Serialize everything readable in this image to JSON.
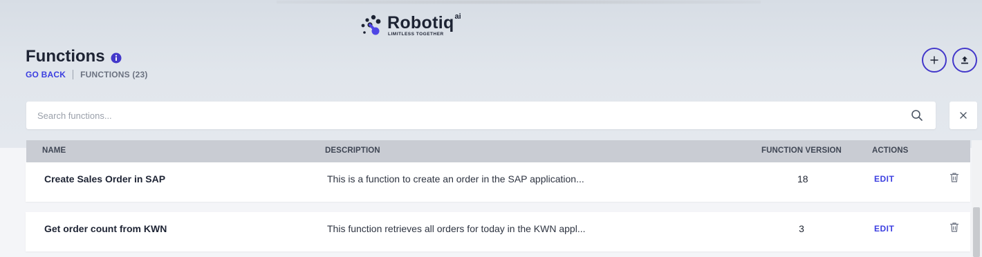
{
  "brand": {
    "name": "Robotiq",
    "superscript": "ai",
    "tagline": "LIMITLESS TOGETHER",
    "accent": "#4338ca",
    "link_color": "#3b3ee0"
  },
  "header": {
    "title": "Functions",
    "info_icon": "info-circle-icon",
    "breadcrumb": {
      "back": "GO BACK",
      "current": "FUNCTIONS (23)"
    },
    "buttons": {
      "add_icon": "plus-icon",
      "upload_icon": "upload-icon"
    }
  },
  "search": {
    "placeholder": "Search functions...",
    "value": "",
    "clear_icon": "close-icon"
  },
  "table": {
    "columns": [
      "NAME",
      "DESCRIPTION",
      "FUNCTION VERSION",
      "ACTIONS"
    ],
    "rows": [
      {
        "name": "Create Sales Order in SAP",
        "description": "This is a function to create an order in the SAP application...",
        "version": "18",
        "edit": "EDIT"
      },
      {
        "name": "Get order count from KWN",
        "description": "This function retrieves all orders for today in the KWN appl...",
        "version": "3",
        "edit": "EDIT"
      }
    ]
  }
}
